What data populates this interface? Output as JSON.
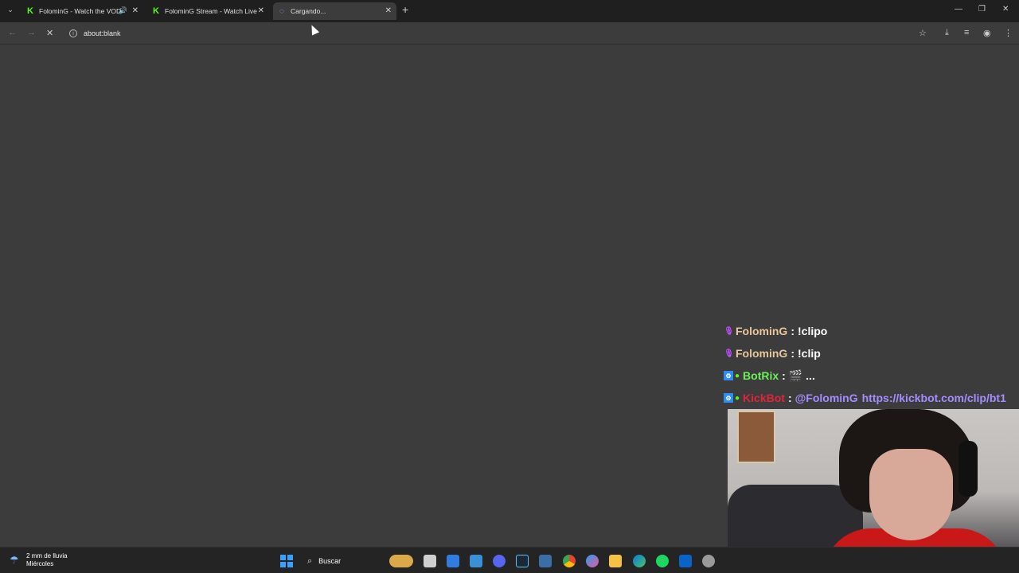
{
  "browser": {
    "tabs": [
      {
        "title": "FolominG - Watch the VOD",
        "favicon": "kick-logo-icon",
        "has_audio": true
      },
      {
        "title": "FolominG Stream - Watch Live",
        "favicon": "kick-logo-icon",
        "has_audio": false
      },
      {
        "title": "Cargando...",
        "favicon": "loading-spinner-icon",
        "active": true
      }
    ],
    "address": "about:blank"
  },
  "chat": {
    "messages": [
      {
        "user": "FolominG",
        "user_color": "#e8c79a",
        "badges": [
          "mic-icon"
        ],
        "text": "!clipo"
      },
      {
        "user": "FolominG",
        "user_color": "#e8c79a",
        "badges": [
          "mic-icon"
        ],
        "text": "!clip"
      },
      {
        "user": "BotRix",
        "user_color": "#6cf05a",
        "badges": [
          "bot-icon",
          "verified-icon"
        ],
        "text": "🎬 ..."
      },
      {
        "user": "KickBot",
        "user_color": "#e0243a",
        "badges": [
          "bot-icon",
          "verified-icon"
        ],
        "mention": "@FolominG",
        "link": "https://kickbot.com/clip/bt1"
      }
    ]
  },
  "taskbar": {
    "weather_line1": "2 mm de lluvia",
    "weather_line2": "Miércoles",
    "search_label": "Buscar",
    "apps": [
      "file-icon",
      "todo-icon",
      "bookmark-icon",
      "discord-icon",
      "steam-icon",
      "calculator-icon",
      "chrome-icon",
      "copilot-icon",
      "folder-icon",
      "edge-icon",
      "spotify-icon",
      "mail-icon",
      "settings-icon"
    ]
  },
  "colors": {
    "kick_green": "#53fc18",
    "link_purple": "#a58cff",
    "accent_blue": "#3aa0ff"
  }
}
